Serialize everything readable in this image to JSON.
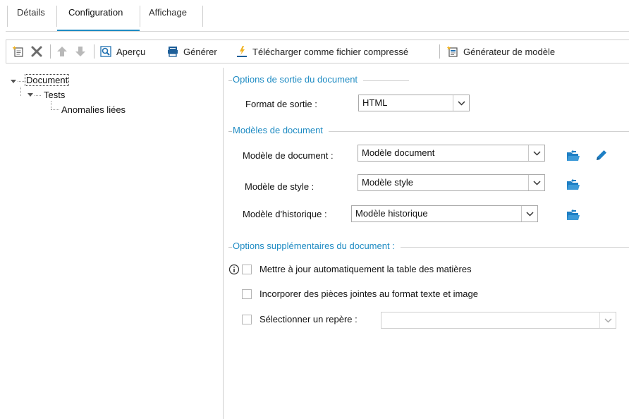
{
  "tabs": [
    {
      "label": "Détails"
    },
    {
      "label": "Configuration"
    },
    {
      "label": "Affichage"
    }
  ],
  "toolbar": {
    "preview_label": "Aperçu",
    "generate_label": "Générer",
    "download_label": "Télécharger comme fichier compressé",
    "template_generator_label": "Générateur de modèle"
  },
  "tree": {
    "root": "Document",
    "child": "Tests",
    "grandchild": "Anomalies liées"
  },
  "output_options": {
    "title": "Options de sortie du document",
    "format_label": "Format de sortie :",
    "format_value": "HTML"
  },
  "templates": {
    "title": "Modèles de document",
    "document_label": "Modèle de document :",
    "document_value": "Modèle document",
    "style_label": "Modèle de style :",
    "style_value": "Modèle style",
    "history_label": "Modèle d'historique :",
    "history_value": "Modèle historique"
  },
  "extra_options": {
    "title": "Options supplémentaires du document :",
    "toc_label": "Mettre à jour automatiquement la table des matières",
    "attachments_label": "Incorporer des pièces jointes au format texte et image",
    "bookmark_label": "Sélectionner un repère :",
    "bookmark_value": ""
  },
  "colors": {
    "accent": "#1e8bc3",
    "folder_icon": "#1e7fc4"
  }
}
